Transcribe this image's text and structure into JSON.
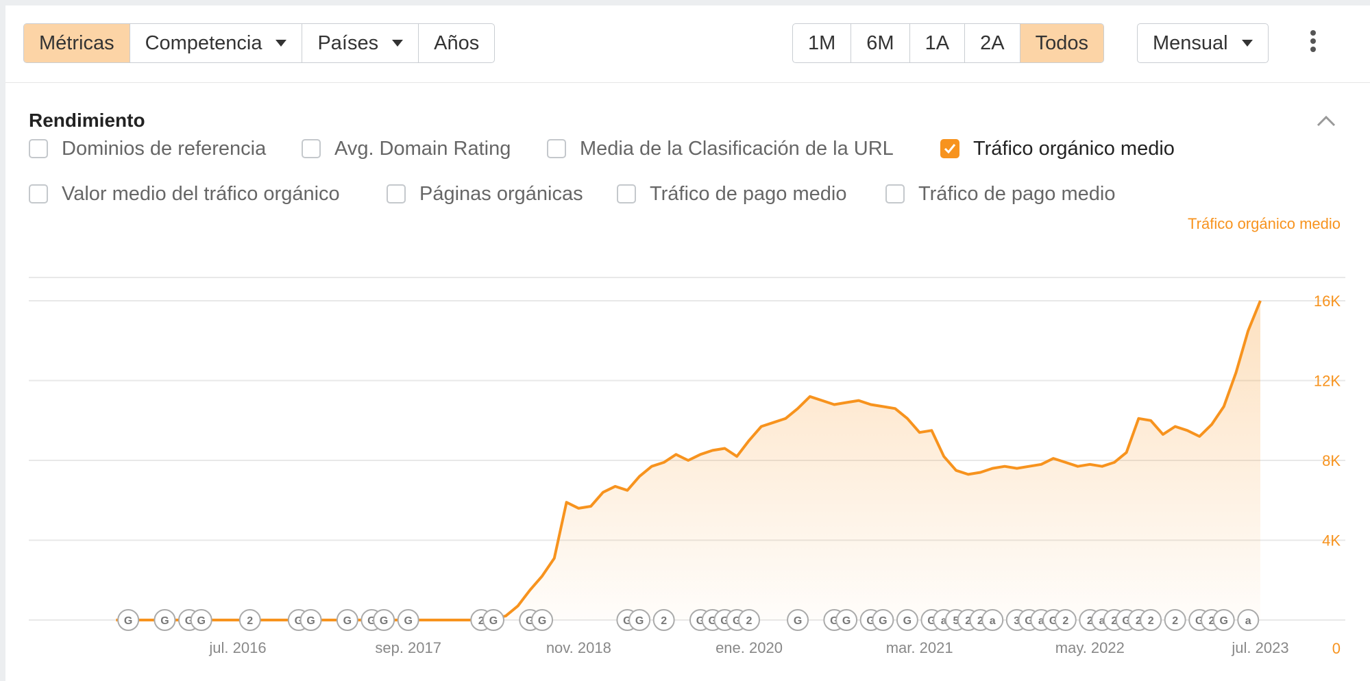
{
  "toolbar": {
    "view_tabs": [
      "Métricas",
      "Competencia",
      "Países",
      "Años"
    ],
    "range_tabs": [
      "1M",
      "6M",
      "1A",
      "2A",
      "Todos"
    ],
    "interval": "Mensual",
    "accent_color": "#f7931e",
    "active_bg_color": "#fcd4a6"
  },
  "section": {
    "title": "Rendimiento"
  },
  "metrics": [
    {
      "label": "Dominios de referencia",
      "checked": false
    },
    {
      "label": "Avg. Domain Rating",
      "checked": false
    },
    {
      "label": "Media de la Clasificación de la URL",
      "checked": false
    },
    {
      "label": "Tráfico orgánico medio",
      "checked": true
    },
    {
      "label": "Valor medio del tráfico orgánico",
      "checked": false
    },
    {
      "label": "Páginas orgánicas",
      "checked": false
    },
    {
      "label": "Tráfico de pago medio",
      "checked": false
    },
    {
      "label": "Tráfico de pago medio",
      "checked": false
    }
  ],
  "chart_data": {
    "type": "area",
    "series": [
      {
        "name": "Tráfico orgánico medio",
        "color": "#f7931e",
        "values": [
          [
            "2015-09",
            0
          ],
          [
            "2016-12",
            0
          ],
          [
            "2018-03",
            0
          ],
          [
            "2018-04",
            100
          ],
          [
            "2018-05",
            200
          ],
          [
            "2018-06",
            700
          ],
          [
            "2018-07",
            1500
          ],
          [
            "2018-08",
            2200
          ],
          [
            "2018-09",
            3100
          ],
          [
            "2018-10",
            5900
          ],
          [
            "2018-11",
            5600
          ],
          [
            "2018-12",
            5700
          ],
          [
            "2019-01",
            6400
          ],
          [
            "2019-02",
            6700
          ],
          [
            "2019-03",
            6500
          ],
          [
            "2019-04",
            7200
          ],
          [
            "2019-05",
            7700
          ],
          [
            "2019-06",
            7900
          ],
          [
            "2019-07",
            8300
          ],
          [
            "2019-08",
            8000
          ],
          [
            "2019-09",
            8300
          ],
          [
            "2019-10",
            8500
          ],
          [
            "2019-11",
            8600
          ],
          [
            "2019-12",
            8200
          ],
          [
            "2020-01",
            9000
          ],
          [
            "2020-02",
            9700
          ],
          [
            "2020-03",
            9900
          ],
          [
            "2020-04",
            10100
          ],
          [
            "2020-05",
            10600
          ],
          [
            "2020-06",
            11200
          ],
          [
            "2020-07",
            11000
          ],
          [
            "2020-08",
            10800
          ],
          [
            "2020-09",
            10900
          ],
          [
            "2020-10",
            11000
          ],
          [
            "2020-11",
            10800
          ],
          [
            "2020-12",
            10700
          ],
          [
            "2021-01",
            10600
          ],
          [
            "2021-02",
            10100
          ],
          [
            "2021-03",
            9400
          ],
          [
            "2021-04",
            9500
          ],
          [
            "2021-05",
            8200
          ],
          [
            "2021-06",
            7500
          ],
          [
            "2021-07",
            7300
          ],
          [
            "2021-08",
            7400
          ],
          [
            "2021-09",
            7600
          ],
          [
            "2021-10",
            7700
          ],
          [
            "2021-11",
            7600
          ],
          [
            "2021-12",
            7700
          ],
          [
            "2022-01",
            7800
          ],
          [
            "2022-02",
            8100
          ],
          [
            "2022-03",
            7900
          ],
          [
            "2022-04",
            7700
          ],
          [
            "2022-05",
            7800
          ],
          [
            "2022-06",
            7700
          ],
          [
            "2022-07",
            7900
          ],
          [
            "2022-08",
            8400
          ],
          [
            "2022-09",
            10100
          ],
          [
            "2022-10",
            10000
          ],
          [
            "2022-11",
            9300
          ],
          [
            "2022-12",
            9700
          ],
          [
            "2023-01",
            9500
          ],
          [
            "2023-02",
            9200
          ],
          [
            "2023-03",
            9800
          ],
          [
            "2023-04",
            10700
          ],
          [
            "2023-05",
            12400
          ],
          [
            "2023-06",
            14500
          ],
          [
            "2023-07",
            16000
          ]
        ]
      }
    ],
    "y_axis_title": "Tráfico orgánico medio",
    "y_ticks": [
      "0",
      "4K",
      "8K",
      "12K",
      "16K"
    ],
    "y_tick_values": [
      0,
      4000,
      8000,
      12000,
      16000
    ],
    "ylim": [
      0,
      16000
    ],
    "x_ticks": [
      {
        "label": "jul. 2016",
        "date": "2016-07"
      },
      {
        "label": "sep. 2017",
        "date": "2017-09"
      },
      {
        "label": "nov. 2018",
        "date": "2018-11"
      },
      {
        "label": "ene. 2020",
        "date": "2020-01"
      },
      {
        "label": "mar. 2021",
        "date": "2021-03"
      },
      {
        "label": "may. 2022",
        "date": "2022-05"
      },
      {
        "label": "jul. 2023",
        "date": "2023-07"
      }
    ],
    "grid": true,
    "annotations": [
      {
        "date": "2015-10",
        "text": "G"
      },
      {
        "date": "2016-01",
        "text": "G"
      },
      {
        "date": "2016-03",
        "text": "G"
      },
      {
        "date": "2016-04",
        "text": "G"
      },
      {
        "date": "2016-08",
        "text": "2"
      },
      {
        "date": "2016-12",
        "text": "G"
      },
      {
        "date": "2017-01",
        "text": "G"
      },
      {
        "date": "2017-04",
        "text": "G"
      },
      {
        "date": "2017-06",
        "text": "G"
      },
      {
        "date": "2017-07",
        "text": "G"
      },
      {
        "date": "2017-09",
        "text": "G"
      },
      {
        "date": "2018-03",
        "text": "2"
      },
      {
        "date": "2018-04",
        "text": "G"
      },
      {
        "date": "2018-07",
        "text": "G"
      },
      {
        "date": "2018-08",
        "text": "G"
      },
      {
        "date": "2019-03",
        "text": "G"
      },
      {
        "date": "2019-04",
        "text": "G"
      },
      {
        "date": "2019-06",
        "text": "2"
      },
      {
        "date": "2019-09",
        "text": "G"
      },
      {
        "date": "2019-10",
        "text": "G"
      },
      {
        "date": "2019-11",
        "text": "G"
      },
      {
        "date": "2019-12",
        "text": "G"
      },
      {
        "date": "2020-01",
        "text": "2"
      },
      {
        "date": "2020-05",
        "text": "G"
      },
      {
        "date": "2020-08",
        "text": "G"
      },
      {
        "date": "2020-09",
        "text": "G"
      },
      {
        "date": "2020-11",
        "text": "G"
      },
      {
        "date": "2020-12",
        "text": "G"
      },
      {
        "date": "2021-02",
        "text": "G"
      },
      {
        "date": "2021-04",
        "text": "G"
      },
      {
        "date": "2021-05",
        "text": "a"
      },
      {
        "date": "2021-06",
        "text": "5"
      },
      {
        "date": "2021-07",
        "text": "2"
      },
      {
        "date": "2021-08",
        "text": "2"
      },
      {
        "date": "2021-09",
        "text": "a"
      },
      {
        "date": "2021-11",
        "text": "3"
      },
      {
        "date": "2021-12",
        "text": "G"
      },
      {
        "date": "2022-01",
        "text": "a"
      },
      {
        "date": "2022-02",
        "text": "G"
      },
      {
        "date": "2022-03",
        "text": "2"
      },
      {
        "date": "2022-05",
        "text": "2"
      },
      {
        "date": "2022-06",
        "text": "a"
      },
      {
        "date": "2022-07",
        "text": "2"
      },
      {
        "date": "2022-08",
        "text": "G"
      },
      {
        "date": "2022-09",
        "text": "2"
      },
      {
        "date": "2022-10",
        "text": "2"
      },
      {
        "date": "2022-12",
        "text": "2"
      },
      {
        "date": "2023-02",
        "text": "G"
      },
      {
        "date": "2023-03",
        "text": "2"
      },
      {
        "date": "2023-04",
        "text": "G"
      },
      {
        "date": "2023-06",
        "text": "a"
      }
    ]
  }
}
